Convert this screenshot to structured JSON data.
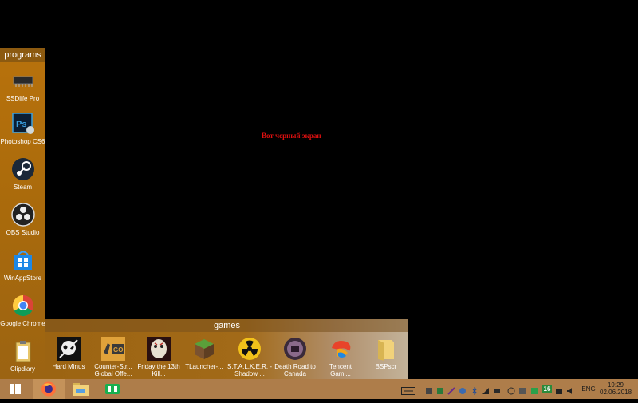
{
  "desktop": {
    "message": "Вот черный экран"
  },
  "fences": {
    "programs": {
      "title": "programs",
      "items": [
        {
          "label": "SSDlife Pro",
          "icon": "ssd-chip-icon"
        },
        {
          "label": "Photoshop CS6",
          "icon": "photoshop-icon"
        },
        {
          "label": "Steam",
          "icon": "steam-icon"
        },
        {
          "label": "OBS Studio",
          "icon": "obs-icon"
        },
        {
          "label": "WinAppStore",
          "icon": "windows-store-icon"
        },
        {
          "label": "Google Chrome",
          "icon": "chrome-icon"
        },
        {
          "label": "Clipdiary",
          "icon": "clipboard-icon"
        }
      ]
    },
    "games": {
      "title": "games",
      "items": [
        {
          "label": "Hard Minus",
          "icon": "hard-minus-icon"
        },
        {
          "label": "Counter-Str... Global Offe...",
          "icon": "csgo-icon"
        },
        {
          "label": "Friday the 13th Kill...",
          "icon": "friday-13th-icon"
        },
        {
          "label": "TLauncher-...",
          "icon": "minecraft-icon"
        },
        {
          "label": "S.T.A.L.K.E.R. - Shadow ...",
          "icon": "stalker-icon"
        },
        {
          "label": "Death Road to Canada",
          "icon": "death-road-icon"
        },
        {
          "label": "Tencent Gami...",
          "icon": "tencent-icon"
        },
        {
          "label": "BSPscr",
          "icon": "folder-icon"
        }
      ]
    }
  },
  "taskbar": {
    "pinned": [
      "windows-start-icon",
      "firefox-icon",
      "file-explorer-icon",
      "green-app-icon"
    ],
    "tray": {
      "language": "ENG",
      "badge": "16",
      "time": "19:29",
      "date": "02.06.2018"
    }
  },
  "colors": {
    "message": "#e01010",
    "fence_orange": "#a96a0c",
    "taskbar": "#ae7d4a"
  }
}
